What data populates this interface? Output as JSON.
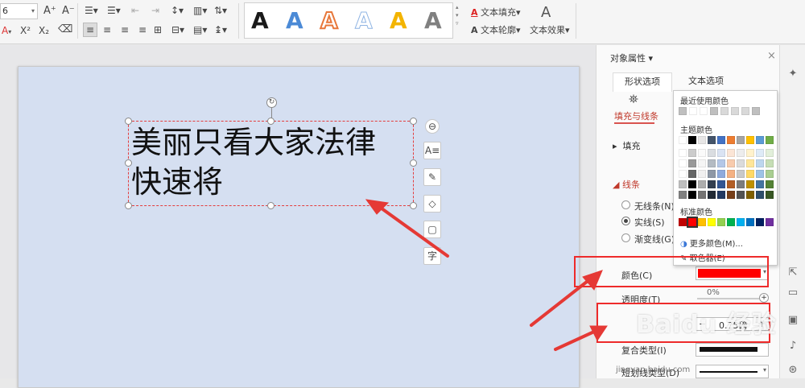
{
  "ribbon": {
    "font_size": "6",
    "text_fill": "文本填充",
    "text_outline": "文本轮廓",
    "text_effect": "文本效果",
    "wordart_glyph": "A",
    "wordart_colors": [
      "#1a1a1a",
      "#4b8ad6",
      "#e8773a",
      "#8fb4e3",
      "#f3b400",
      "#808080"
    ],
    "grow_font": "A⁺",
    "shrink_font": "A⁻",
    "superscript": "X²",
    "subscript": "X₂",
    "text_effect_icon": "A"
  },
  "slide": {
    "textbox_line1": "美丽只看大家法律",
    "textbox_line2": "快速将",
    "float_tools": [
      "⊖",
      "A≡",
      "✎",
      "◇",
      "▢",
      "字"
    ]
  },
  "panel": {
    "title": "对象属性",
    "tab_shape": "形状选项",
    "tab_text": "文本选项",
    "subtab_fill_line": "填充与线条",
    "section_fill": "填充",
    "section_line": "线条",
    "no_line": "无线条(N)",
    "solid_line": "实线(S)",
    "gradient_line": "渐变线(G)",
    "color_label": "颜色(C)",
    "color_value": "#ff0000",
    "transparency_label": "透明度(T)",
    "transparency_value": "0%",
    "width_value": "0.75磅",
    "compound_label": "复合类型(I)",
    "dash_label": "短划线类型(D)"
  },
  "color_popup": {
    "recent_title": "最近使用颜色",
    "theme_title": "主题颜色",
    "standard_title": "标准颜色",
    "more_colors": "更多颜色(M)...",
    "eyedropper": "取色器(E)",
    "recent": [
      "#bfbfbf",
      "#ffffff",
      "#ffffff",
      "#bfbfbf",
      "#d9d9d9",
      "#d9d9d9",
      "#d9d9d9",
      "#bfbfbf"
    ],
    "theme_top": [
      "#ffffff",
      "#000000",
      "#e7e6e6",
      "#44546a",
      "#4472c4",
      "#ed7d31",
      "#a5a5a5",
      "#ffc000",
      "#5b9bd5",
      "#70ad47"
    ],
    "standard": [
      "#c00000",
      "#ff0000",
      "#ffc000",
      "#ffff00",
      "#92d050",
      "#00b050",
      "#00b0f0",
      "#0070c0",
      "#002060",
      "#7030a0"
    ]
  },
  "watermark": {
    "brand": "Baidu 经验",
    "url": "jingyan.baidu.com"
  }
}
